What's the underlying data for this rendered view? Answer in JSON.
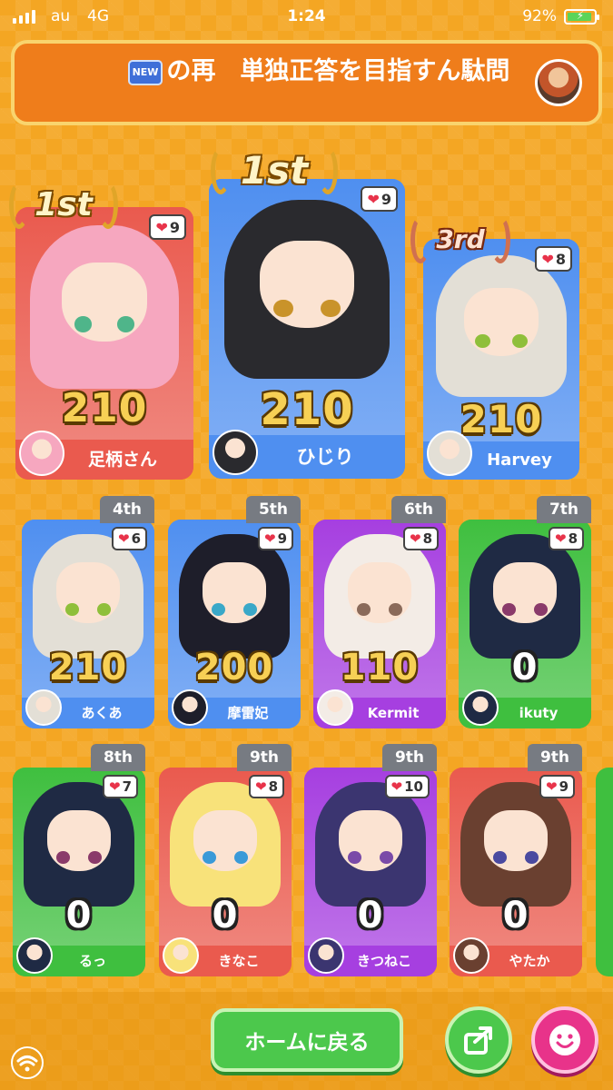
{
  "status_bar": {
    "carrier": "au",
    "network": "4G",
    "time": "1:24",
    "battery": "92%"
  },
  "title": {
    "new_badge": "NEW",
    "text": "の再　単独正答を目指すん駄問"
  },
  "players": [
    {
      "rank": "1st",
      "name": "足柄さん",
      "score": "210",
      "hearts": "9",
      "card_color": "#ea5a4e",
      "hair": "#f6a7bf",
      "eye": "#4fb58a"
    },
    {
      "rank": "1st",
      "name": "ひじり",
      "score": "210",
      "hearts": "9",
      "card_color": "#4f8ff0",
      "hair": "#2a2a2e",
      "eye": "#c9932a"
    },
    {
      "rank": "3rd",
      "name": "Harvey",
      "score": "210",
      "hearts": "8",
      "card_color": "#4f8ff0",
      "hair": "#e3dfd6",
      "eye": "#8fbf3a"
    },
    {
      "rank": "4th",
      "name": "あくあ",
      "score": "210",
      "hearts": "6",
      "card_color": "#4f8ff0",
      "hair": "#e3dfd6",
      "eye": "#8fbf3a"
    },
    {
      "rank": "5th",
      "name": "摩雷妃",
      "score": "200",
      "hearts": "9",
      "card_color": "#4f8ff0",
      "hair": "#1e1e2a",
      "eye": "#3aa8c8"
    },
    {
      "rank": "6th",
      "name": "Kermit",
      "score": "110",
      "hearts": "8",
      "card_color": "#a63fe0",
      "hair": "#f3ece6",
      "eye": "#8a6a5a"
    },
    {
      "rank": "7th",
      "name": "ikuty",
      "score": "0",
      "hearts": "8",
      "card_color": "#3fbf3f",
      "hair": "#1f2a44",
      "eye": "#8a3a6a"
    },
    {
      "rank": "8th",
      "name": "るっ",
      "score": "0",
      "hearts": "7",
      "card_color": "#3fbf3f",
      "hair": "#1f2a44",
      "eye": "#8a3a6a"
    },
    {
      "rank": "9th",
      "name": "きなこ",
      "score": "0",
      "hearts": "8",
      "card_color": "#ea5a4e",
      "hair": "#f8e27a",
      "eye": "#3a9ad8"
    },
    {
      "rank": "9th",
      "name": "きつねこ",
      "score": "0",
      "hearts": "10",
      "card_color": "#a63fe0",
      "hair": "#3b3570",
      "eye": "#7a4aa8"
    },
    {
      "rank": "9th",
      "name": "やたか",
      "score": "0",
      "hearts": "9",
      "card_color": "#ea5a4e",
      "hair": "#6a4030",
      "eye": "#4a4aa0"
    }
  ],
  "actions": {
    "home_label": "ホームに戻る",
    "share_icon": "share-icon",
    "reaction_icon": "smiley-icon"
  },
  "colors": {
    "background": "#f4a623",
    "banner": "#ef7d1b",
    "button_green": "#4cc84c",
    "button_pink": "#e8338a"
  }
}
